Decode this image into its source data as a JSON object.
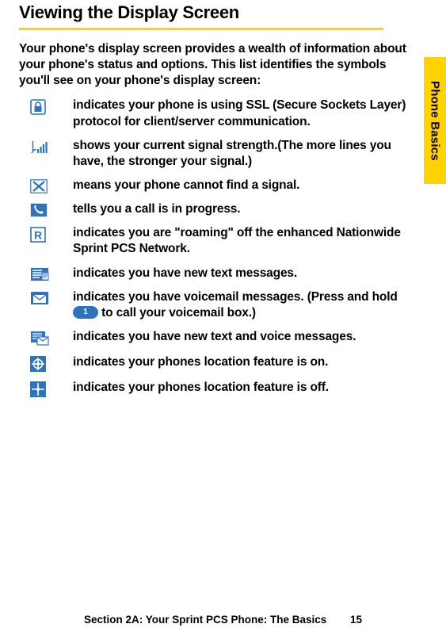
{
  "title": "Viewing the Display Screen",
  "intro": "Your phone's display screen provides a wealth of information about your phone's status and options. This list identifies the symbols you'll see on your phone's display screen:",
  "side_tab": "Phone Basics",
  "items": [
    {
      "text": "indicates your phone is using SSL (Secure Sockets Layer) protocol for client/server communication."
    },
    {
      "text": "shows your current signal strength.(The more lines you have, the stronger your signal.)"
    },
    {
      "text": "means your phone cannot find a signal."
    },
    {
      "text": "tells you a call is in progress."
    },
    {
      "text": "indicates you are \"roaming\" off the enhanced Nationwide Sprint PCS Network."
    },
    {
      "text": "indicates you have new text messages."
    },
    {
      "text_before": "indicates you have voicemail messages. (Press and hold ",
      "key": "1",
      "text_after": " to call your voicemail box.)"
    },
    {
      "text": "indicates you have new text and voice messages."
    },
    {
      "text": "indicates your phones location feature is on."
    },
    {
      "text": "indicates your phones location feature is off."
    }
  ],
  "footer_section": "Section 2A: Your Sprint PCS Phone: The Basics",
  "footer_page": "15"
}
